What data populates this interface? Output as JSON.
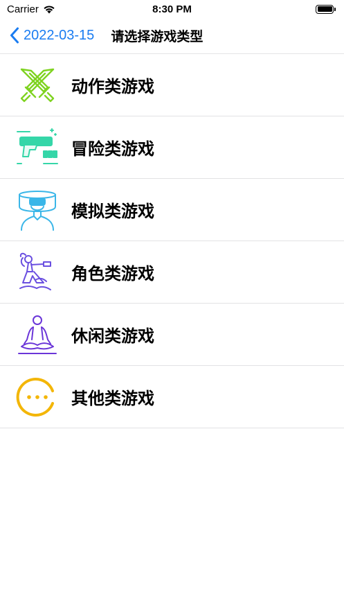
{
  "status_bar": {
    "carrier": "Carrier",
    "time": "8:30 PM",
    "battery_level": 1.0
  },
  "nav": {
    "back_label": "2022-03-15",
    "title": "请选择游戏类型",
    "accent_color": "#1a7cf1"
  },
  "categories": [
    {
      "label": "动作类游戏",
      "icon": "crossed-swords-icon",
      "color": "#7fd321"
    },
    {
      "label": "冒险类游戏",
      "icon": "gun-icon",
      "color": "#35d6a8"
    },
    {
      "label": "模拟类游戏",
      "icon": "vr-headset-icon",
      "color": "#3ab6e8"
    },
    {
      "label": "角色类游戏",
      "icon": "character-icon",
      "color": "#6a4fe0"
    },
    {
      "label": "休闲类游戏",
      "icon": "meditation-icon",
      "color": "#6a35d8"
    },
    {
      "label": "其他类游戏",
      "icon": "more-icon",
      "color": "#f3b608"
    }
  ]
}
